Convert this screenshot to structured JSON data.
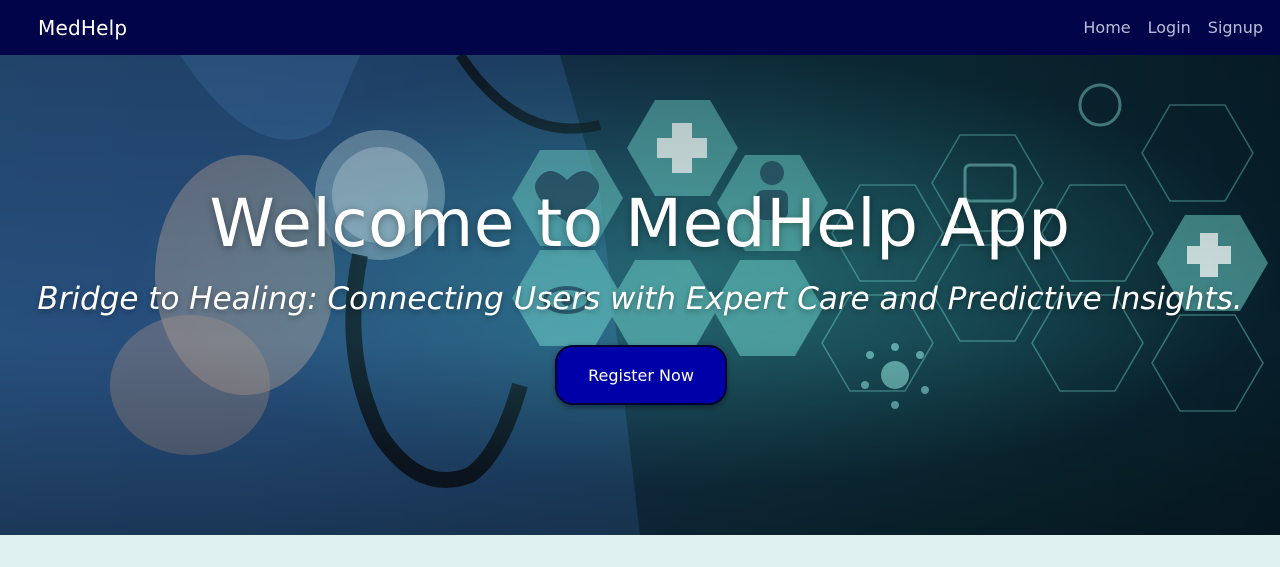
{
  "navbar": {
    "brand": "MedHelp",
    "links": [
      {
        "label": "Home"
      },
      {
        "label": "Login"
      },
      {
        "label": "Signup"
      }
    ]
  },
  "hero": {
    "title": "Welcome to MedHelp App",
    "subtitle": "Bridge to Healing: Connecting Users with Expert Care and Predictive Insights.",
    "cta_label": "Register Now"
  },
  "colors": {
    "navbar_bg": "#02044a",
    "button_bg": "#0000a8",
    "lower_band_bg": "#dff2ef"
  }
}
